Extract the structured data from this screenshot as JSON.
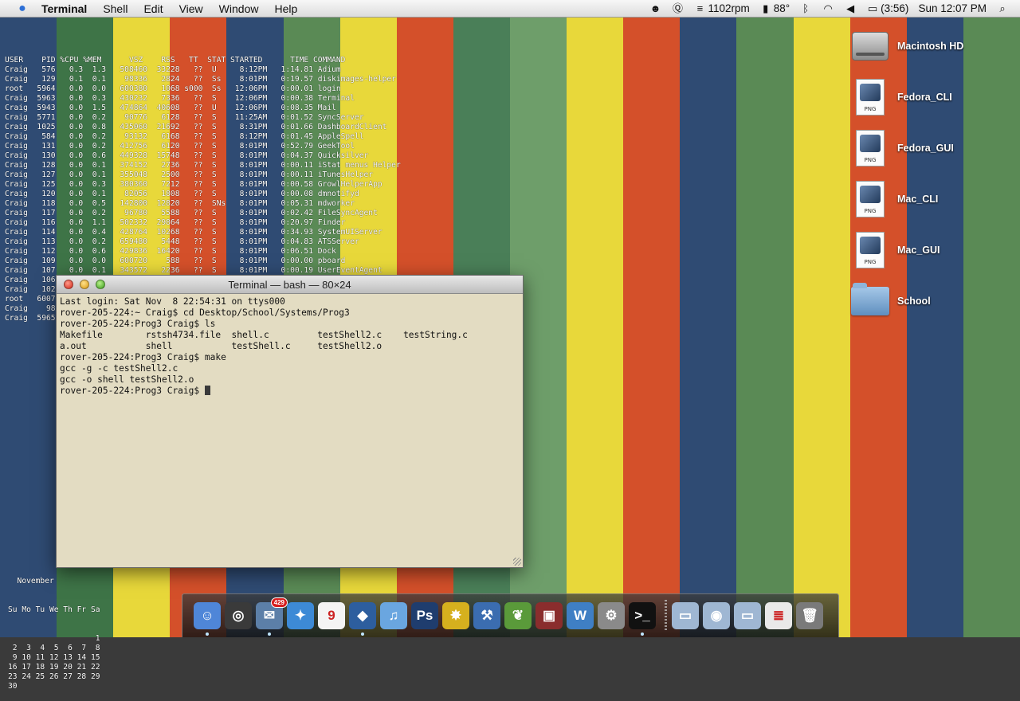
{
  "wallpaper": {
    "stripes": [
      "#2f4b73",
      "#3e7447",
      "#e8d83a",
      "#d4502a",
      "#2f4b73",
      "#5a8a55",
      "#e8d83a",
      "#d4502a",
      "#4a7f58",
      "#6e9e6a",
      "#e8d83a",
      "#d4502a",
      "#2f4b73",
      "#5a8a55",
      "#e8d83a",
      "#d4502a",
      "#2f4b73",
      "#5a8a55"
    ]
  },
  "menubar": {
    "app_name": "Terminal",
    "menus": [
      "Shell",
      "Edit",
      "View",
      "Window",
      "Help"
    ],
    "status": {
      "fan": "1102rpm",
      "temp": "88°",
      "battery": "(3:56)",
      "clock": "Sun 12:07 PM"
    }
  },
  "ps": {
    "header": "USER    PID %CPU %MEM      VSZ    RSS   TT  STAT STARTED      TIME COMMAND",
    "rows": [
      "Craig   576   0.3  1.3   508460  33228   ??  U     8:12PM   1:14.81 Adium",
      "Craig   129   0.1  0.1    98336   2824   ??  Ss    8:01PM   0:19.57 diskimages-helper",
      "root   5964   0.0  0.0   600380   1068 s000  Ss   12:06PM   0:00.01 login",
      "Craig  5963   0.0  0.3   430232   7336   ??  S    12:06PM   0:00.38 Terminal",
      "Craig  5943   0.0  1.5   474864  40608   ??  U    12:06PM   0:08.35 Mail",
      "Craig  5771   0.0  0.2    90776   6128   ??  S    11:25AM   0:01.52 SyncServer",
      "Craig  1025   0.0  0.8   435060  21692   ??  S     8:31PM   0:01.66 DashboardClient",
      "Craig   584   0.0  0.2    93132   6168   ??  S     8:12PM   0:01.45 AppleSpell",
      "Craig   131   0.0  0.2   412756   6120   ??  S     8:01PM   0:52.79 GeekTool",
      "Craig   130   0.0  0.6   449328  15748   ??  S     8:01PM   0:04.37 Quicksilver",
      "Craig   128   0.0  0.1   374152   2736   ??  S     8:01PM   0:00.11 iStat menus Helper",
      "Craig   127   0.0  0.1   355048   2500   ??  S     8:01PM   0:00.11 iTunesHelper",
      "Craig   125   0.0  0.3   380360   7212   ??  S     8:01PM   0:00.58 GrowlHelperApp",
      "Craig   120   0.0  0.1    82056   1808   ??  S     8:01PM   0:00.08 dmnotifyd",
      "Craig   118   0.0  0.5   142800  12820   ??  SNs   8:01PM   0:05.31 mdworker",
      "Craig   117   0.0  0.2    96780   5588   ??  S     8:01PM   0:02.42 FileSyncAgent",
      "Craig   116   0.0  1.1   502332  29864   ??  S     8:01PM   0:20.97 Finder",
      "Craig   114   0.0  0.4   428764  10268   ??  S     8:01PM   0:34.93 SystemUIServer",
      "Craig   113   0.0  0.2   659480   5448   ??  S     8:01PM   0:04.83 ATSServer",
      "Craig   112   0.0  0.6   429836  16420   ??  S     8:01PM   0:06.51 Dock",
      "Craig   109   0.0  0.0   600720    588   ??  S     8:01PM   0:00.00 pboard",
      "Craig   107   0.0  0.1   343572   2236   ??  S     8:01PM   0:00.19 UserEventAgent",
      "Craig   106",
      "Craig   102",
      "root   6007",
      "Craig    98",
      "Craig  5965"
    ]
  },
  "calendar": {
    "month": "  November",
    "weekdays": "Su Mo Tu We Th Fr Sa",
    "weeks": [
      "                   1",
      " 2  3  4  5  6  7  8",
      " 9 10 11 12 13 14 15",
      "16 17 18 19 20 21 22",
      "23 24 25 26 27 28 29",
      "30"
    ]
  },
  "terminal": {
    "title": "Terminal — bash — 80×24",
    "lines": [
      "Last login: Sat Nov  8 22:54:31 on ttys000",
      "rover-205-224:~ Craig$ cd Desktop/School/Systems/Prog3",
      "rover-205-224:Prog3 Craig$ ls",
      "Makefile        rstsh4734.file  shell.c         testShell2.c    testString.c",
      "a.out           shell           testShell.c     testShell2.o",
      "rover-205-224:Prog3 Craig$ make",
      "gcc -g -c testShell2.c",
      "gcc -o shell testShell2.o"
    ],
    "prompt": "rover-205-224:Prog3 Craig$ "
  },
  "desktop_icons": [
    {
      "label": "Macintosh HD",
      "kind": "hd-icon"
    },
    {
      "label": "Fedora_CLI",
      "kind": "png-file-icon",
      "tag": "PNG"
    },
    {
      "label": "Fedora_GUI",
      "kind": "png-file-icon",
      "tag": "PNG"
    },
    {
      "label": "Mac_CLI",
      "kind": "png-file-icon",
      "tag": "PNG"
    },
    {
      "label": "Mac_GUI",
      "kind": "png-file-icon",
      "tag": "PNG"
    },
    {
      "label": "School",
      "kind": "folder-icon"
    }
  ],
  "dock": {
    "badge_count": "429",
    "calendar_day": "9",
    "ps_label": "Ps",
    "items": [
      {
        "name": "finder",
        "color": "#4f86d8",
        "glyph": "☺",
        "running": true
      },
      {
        "name": "dashboard",
        "color": "#3a3a3a",
        "glyph": "◎",
        "running": false
      },
      {
        "name": "mail",
        "color": "#5c7fa8",
        "glyph": "✉",
        "running": true
      },
      {
        "name": "safari",
        "color": "#3d8ad6",
        "glyph": "✦",
        "running": false
      },
      {
        "name": "ical",
        "color": "#f4f4f4",
        "glyph": "9",
        "running": false
      },
      {
        "name": "adium",
        "color": "#2d5e9e",
        "glyph": "◆",
        "running": true
      },
      {
        "name": "itunes",
        "color": "#6aa6e0",
        "glyph": "♫",
        "running": false
      },
      {
        "name": "photoshop",
        "color": "#1f3d6e",
        "glyph": "Ps",
        "running": false
      },
      {
        "name": "smultron",
        "color": "#d6b01e",
        "glyph": "✸",
        "running": false
      },
      {
        "name": "xcode",
        "color": "#3b6db0",
        "glyph": "⚒",
        "running": false
      },
      {
        "name": "growl",
        "color": "#5a9a3a",
        "glyph": "❦",
        "running": false
      },
      {
        "name": "vmware",
        "color": "#8a2d2d",
        "glyph": "▣",
        "running": false
      },
      {
        "name": "word",
        "color": "#3f7fc4",
        "glyph": "W",
        "running": false
      },
      {
        "name": "system-prefs",
        "color": "#8a8a8a",
        "glyph": "⚙",
        "running": false
      },
      {
        "name": "terminal",
        "color": "#111111",
        "glyph": ">_",
        "running": true
      }
    ],
    "right_items": [
      {
        "name": "documents-stack",
        "color": "#9fb7d3",
        "glyph": "▭"
      },
      {
        "name": "downloads-stack",
        "color": "#9fb7d3",
        "glyph": "◉"
      },
      {
        "name": "applications-stack",
        "color": "#9fb7d3",
        "glyph": "▭"
      },
      {
        "name": "document-stack",
        "color": "#e9e9e9",
        "glyph": "≣"
      },
      {
        "name": "trash",
        "color": "#7a7a7a",
        "glyph": "🗑"
      }
    ]
  }
}
